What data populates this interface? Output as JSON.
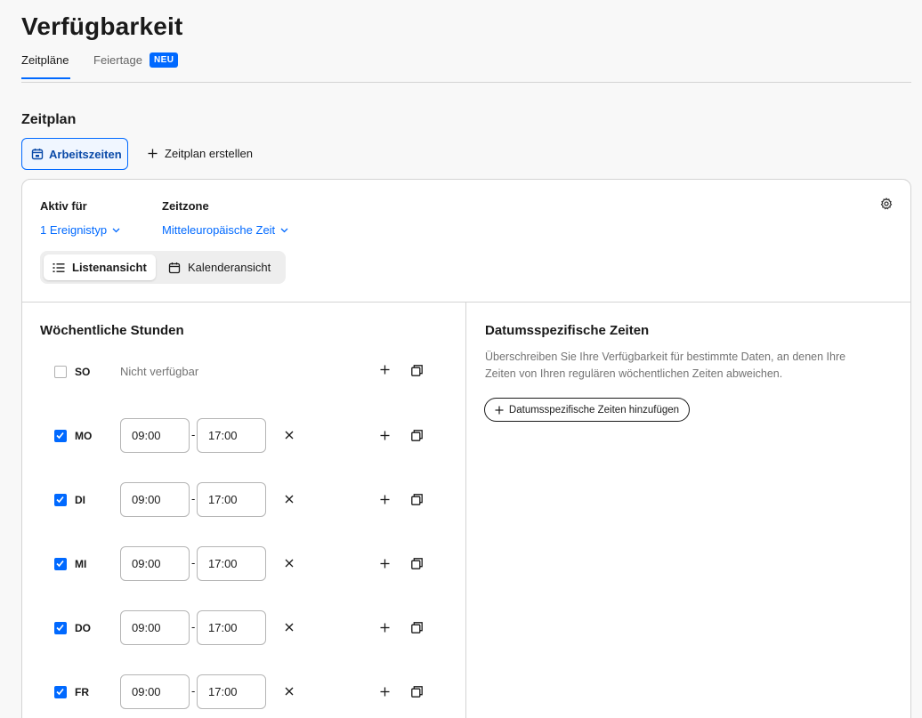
{
  "header": {
    "title": "Verfügbarkeit"
  },
  "tabs": [
    {
      "label": "Zeitpläne",
      "active": true
    },
    {
      "label": "Feiertage",
      "badge": "NEU"
    }
  ],
  "schedule": {
    "section_title": "Zeitplan",
    "active_schedule_label": "Arbeitszeiten",
    "create_label": "Zeitplan erstellen"
  },
  "settings": {
    "active_for_label": "Aktiv für",
    "active_for_value": "1 Ereignistyp",
    "timezone_label": "Zeitzone",
    "timezone_value": "Mitteleuropäische Zeit"
  },
  "view_toggle": {
    "list_label": "Listenansicht",
    "calendar_label": "Kalenderansicht",
    "selected": "list"
  },
  "weekly": {
    "title": "Wöchentliche Stunden",
    "unavailable_label": "Nicht verfügbar",
    "days": [
      {
        "code": "SO",
        "enabled": false,
        "start": "",
        "end": ""
      },
      {
        "code": "MO",
        "enabled": true,
        "start": "09:00",
        "end": "17:00"
      },
      {
        "code": "DI",
        "enabled": true,
        "start": "09:00",
        "end": "17:00"
      },
      {
        "code": "MI",
        "enabled": true,
        "start": "09:00",
        "end": "17:00"
      },
      {
        "code": "DO",
        "enabled": true,
        "start": "09:00",
        "end": "17:00"
      },
      {
        "code": "FR",
        "enabled": true,
        "start": "09:00",
        "end": "17:00"
      }
    ]
  },
  "date_specific": {
    "title": "Datumsspezifische Zeiten",
    "description": "Überschreiben Sie Ihre Verfügbarkeit für bestimmte Daten, an denen Ihre Zeiten von Ihren regulären wöchentlichen Zeiten abweichen.",
    "add_button": "Datumsspezifische Zeiten hinzufügen"
  },
  "colors": {
    "accent": "#0069ff",
    "text": "#1a1a1a",
    "muted": "#737373",
    "border": "#d4d4d4"
  },
  "icons": {
    "schedule": "calendar-icon",
    "add": "plus-icon",
    "settings": "gear-icon",
    "list": "list-icon",
    "calendar": "calendar-icon",
    "copy": "copy-icon",
    "remove": "close-icon",
    "dropdown": "chevron-down-icon"
  }
}
